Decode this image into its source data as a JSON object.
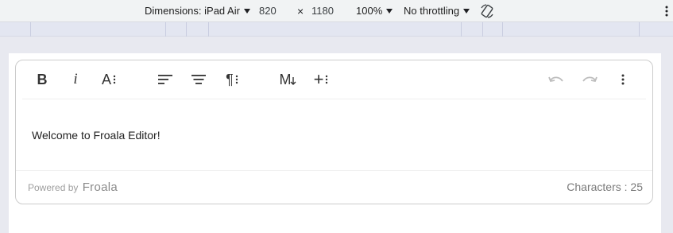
{
  "devtools": {
    "dimensions_label": "Dimensions: iPad Air",
    "width": "820",
    "times": "×",
    "height": "1180",
    "zoom": "100%",
    "throttling": "No throttling",
    "rotate_icon": "rotate-icon",
    "more_icon": "more-vertical-icon"
  },
  "toolbar": {
    "bold": "B",
    "italic": "i",
    "font_size": "A",
    "align_left_icon": "align-left-icon",
    "align_center_icon": "align-center-icon",
    "paragraph": "¶",
    "markdown": "M",
    "insert_more": "+",
    "undo_icon": "undo-icon",
    "redo_icon": "redo-icon",
    "more_icon": "more-vertical-icon"
  },
  "editor": {
    "content": "Welcome to Froala Editor!"
  },
  "footer": {
    "powered_by": "Powered by",
    "brand": "Froala",
    "characters": "Characters : 25"
  }
}
